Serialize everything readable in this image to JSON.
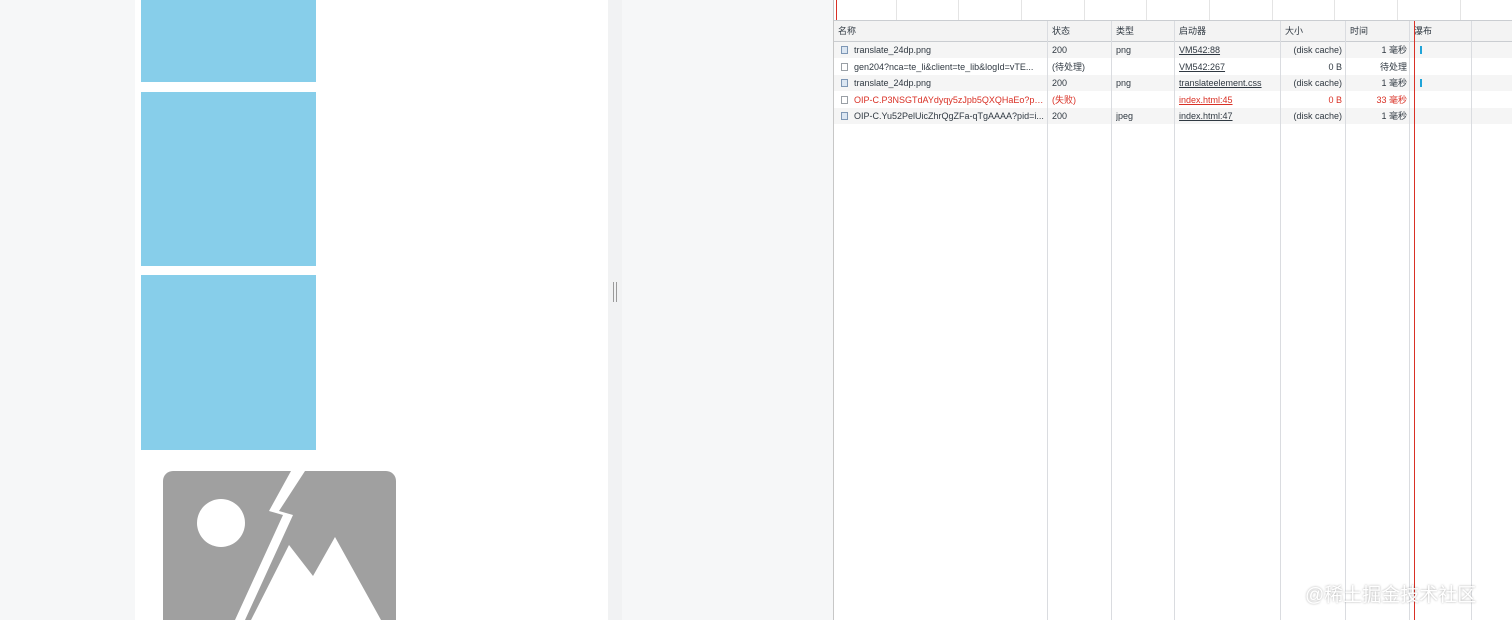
{
  "devtools": {
    "columns": [
      "名称",
      "状态",
      "类型",
      "启动器",
      "大小",
      "时间",
      "瀑布"
    ],
    "rows": [
      {
        "name": "translate_24dp.png",
        "status": "200",
        "type": "png",
        "initiator": "VM542:88",
        "size": "(disk cache)",
        "time": "1 毫秒",
        "icon": "image-file-icon",
        "failed": false,
        "waterfall": true
      },
      {
        "name": "gen204?nca=te_li&client=te_lib&logId=vTE...",
        "status": "(待处理)",
        "type": "",
        "initiator": "VM542:267",
        "size": "0 B",
        "time": "待处理",
        "icon": "document-file-icon",
        "failed": false,
        "waterfall": false
      },
      {
        "name": "translate_24dp.png",
        "status": "200",
        "type": "png",
        "initiator": "translateelement.css",
        "size": "(disk cache)",
        "time": "1 毫秒",
        "icon": "image-file-icon",
        "failed": false,
        "waterfall": true
      },
      {
        "name": "OIP-C.P3NSGTdAYdyqy5zJpb5QXQHaEo?pid...",
        "status": "(失败)",
        "type": "",
        "initiator": "index.html:45",
        "size": "0 B",
        "time": "33 毫秒",
        "icon": "document-file-icon",
        "failed": true,
        "waterfall": false
      },
      {
        "name": "OIP-C.Yu52PelUicZhrQgZFa-qTgAAAA?pid=i...",
        "status": "200",
        "type": "jpeg",
        "initiator": "index.html:47",
        "size": "(disk cache)",
        "time": "1 毫秒",
        "icon": "image-file-icon",
        "failed": false,
        "waterfall": false
      }
    ]
  },
  "colors": {
    "placeholder_tile": "#87ceea",
    "failed_text": "#d93025",
    "waterfall_bar": "#20a4d8",
    "broken_image_gray": "#a0a0a0"
  },
  "page": {
    "broken_image_icon": "broken-image-icon"
  },
  "watermark": "@稀土掘金技术社区"
}
